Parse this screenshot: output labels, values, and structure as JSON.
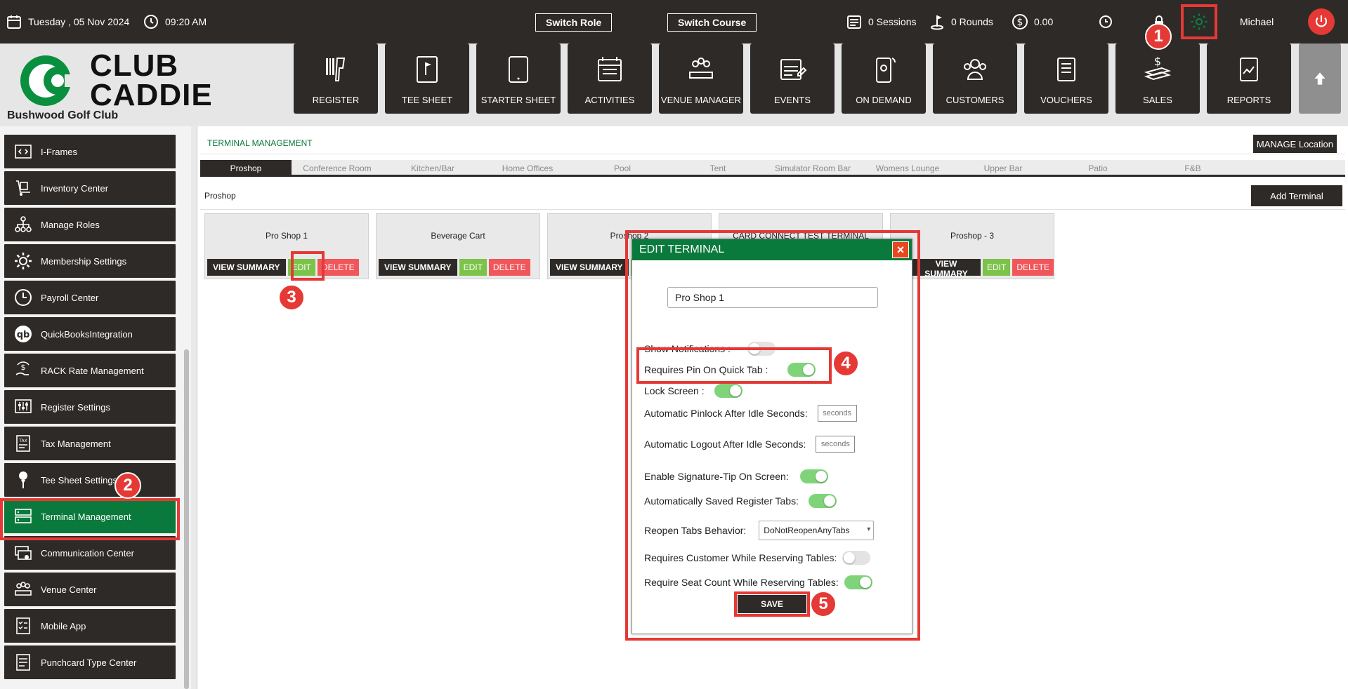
{
  "topbar": {
    "date": "Tuesday ,  05 Nov 2024",
    "time": "09:20 AM",
    "switch_role": "Switch Role",
    "switch_course": "Switch Course",
    "sessions": "0 Sessions",
    "rounds": "0 Rounds",
    "balance": "0.00",
    "user": "Michael"
  },
  "header": {
    "logo_line1": "CLUB",
    "logo_line2": "CADDIE",
    "club_name": "Bushwood Golf Club",
    "tiles": [
      "REGISTER",
      "TEE SHEET",
      "STARTER SHEET",
      "ACTIVITIES",
      "VENUE MANAGER",
      "EVENTS",
      "ON DEMAND",
      "CUSTOMERS",
      "VOUCHERS",
      "SALES",
      "REPORTS"
    ]
  },
  "sidebar": {
    "items": [
      "I-Frames",
      "Inventory Center",
      "Manage Roles",
      "Membership Settings",
      "Payroll Center",
      "QuickBooksIntegration",
      "RACK Rate Management",
      "Register Settings",
      "Tax Management",
      "Tee Sheet Settings",
      "Terminal Management",
      "Communication Center",
      "Venue Center",
      "Mobile App",
      "Punchcard Type Center"
    ],
    "active": "Terminal Management"
  },
  "main": {
    "panel_title": "TERMINAL MANAGEMENT",
    "manage_location": "MANAGE Location",
    "tabs": [
      "Proshop",
      "Conference Room",
      "Kitchen/Bar",
      "Home Offices",
      "Pool",
      "Tent",
      "Simulator Room Bar",
      "Womens Lounge",
      "Upper Bar",
      "Patio",
      "F&B"
    ],
    "active_tab": "Proshop",
    "sub_title": "Proshop",
    "add_terminal": "Add Terminal",
    "cards": [
      {
        "name": "Pro Shop 1"
      },
      {
        "name": "Beverage Cart"
      },
      {
        "name": "Proshop 2"
      },
      {
        "name": "CARD CONNECT TEST TERMINAL"
      },
      {
        "name": "Proshop - 3"
      }
    ],
    "view_summary": "VIEW SUMMARY",
    "edit": "EDIT",
    "delete": "DELETE"
  },
  "modal": {
    "title": "EDIT TERMINAL",
    "close": "×",
    "terminal_name": "Pro Shop 1",
    "show_notifications": "Show Notifications :",
    "requires_pin": "Requires Pin On Quick Tab :",
    "lock_screen": "Lock Screen :",
    "pinlock_label": "Automatic Pinlock After Idle Seconds:",
    "pinlock_placeholder": "seconds",
    "logout_label": "Automatic Logout After Idle Seconds:",
    "logout_placeholder": "seconds",
    "signature_tip": "Enable Signature-Tip On Screen:",
    "auto_saved": "Automatically Saved Register Tabs:",
    "reopen_label": "Reopen Tabs Behavior:",
    "reopen_value": "DoNotReopenAnyTabs",
    "req_customer": "Requires Customer While Reserving Tables:",
    "req_seat": "Require Seat Count While Reserving Tables:",
    "save": "SAVE",
    "toggles": {
      "show_notifications": false,
      "requires_pin": true,
      "lock_screen": true,
      "signature_tip": true,
      "auto_saved": true,
      "req_customer": false,
      "req_seat": true
    }
  },
  "callouts": [
    "1",
    "2",
    "3",
    "4",
    "5"
  ],
  "colors": {
    "brand_green": "#0a7a3c",
    "dark": "#2d2a27",
    "highlight_red": "#e53935",
    "edit_green": "#7cc34a",
    "delete_red": "#f0565a"
  }
}
